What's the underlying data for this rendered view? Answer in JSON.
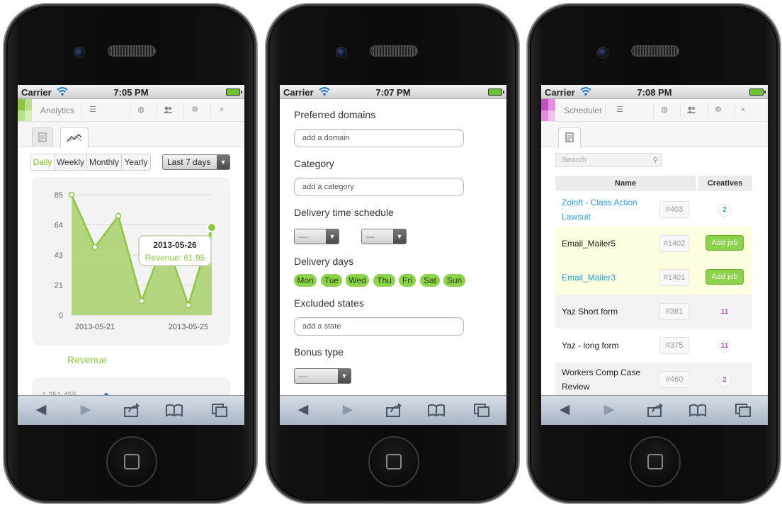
{
  "colors": {
    "accent_green": "#8cc63f",
    "link_blue": "#2a9fd6",
    "badge_purple": "#b050c8",
    "badge_blue": "#2a9fd6"
  },
  "status": {
    "carrier": "Carrier"
  },
  "phone1": {
    "time": "7:05 PM",
    "app_name": "Analytics",
    "periods": [
      "Daily",
      "Weekly",
      "Monthly",
      "Yearly"
    ],
    "active_period": "Daily",
    "range": "Last 7 days",
    "tooltip": {
      "date": "2013-05-26",
      "text": "Revenue: 61.95"
    },
    "revenue_label": "Revenue",
    "second_chart_first_tick": "1,251,455"
  },
  "chart_data": {
    "type": "area",
    "x_ticks": [
      "2013-05-21",
      "2013-05-25"
    ],
    "y_ticks": [
      "85",
      "64",
      "43",
      "21",
      "0"
    ],
    "ylim": [
      0,
      85
    ],
    "x": [
      "2013-05-20",
      "2013-05-21",
      "2013-05-22",
      "2013-05-23",
      "2013-05-24",
      "2013-05-25",
      "2013-05-26"
    ],
    "series": [
      {
        "name": "Revenue",
        "values": [
          85,
          48,
          70,
          10,
          54,
          7,
          61.95
        ]
      }
    ],
    "grid": true
  },
  "phone2": {
    "time": "7:07 PM",
    "preferred_domains_label": "Preferred domains",
    "domain_placeholder": "add a domain",
    "category_label": "Category",
    "category_placeholder": "add a category",
    "delivery_time_label": "Delivery time schedule",
    "dash": "—",
    "delivery_days_label": "Delivery days",
    "days": [
      "Mon",
      "Tue",
      "Wed",
      "Thu",
      "Fri",
      "Sat",
      "Sun"
    ],
    "excluded_states_label": "Excluded states",
    "state_placeholder": "add a state",
    "bonus_type_label": "Bonus type"
  },
  "phone3": {
    "time": "7:08 PM",
    "app_name": "Scheduler",
    "search_placeholder": "Search",
    "col_name": "Name",
    "col_creatives": "Creatives",
    "rows": [
      {
        "name": "Zoloft - Class Action Lawsuit",
        "id": "#403",
        "creatives": "2",
        "link": true
      },
      {
        "name": "Email_Mailer5",
        "id": "#1402",
        "creatives": "Add job",
        "link": false
      },
      {
        "name": "Email_Mailer3",
        "id": "#1401",
        "creatives": "Add job",
        "link": true
      },
      {
        "name": "Yaz Short form",
        "id": "#361",
        "creatives": "11",
        "link": false
      },
      {
        "name": "Yaz - long form",
        "id": "#375",
        "creatives": "11",
        "link": false
      },
      {
        "name": "Workers Comp Case Review",
        "id": "#460",
        "creatives": "2",
        "link": false
      }
    ]
  }
}
